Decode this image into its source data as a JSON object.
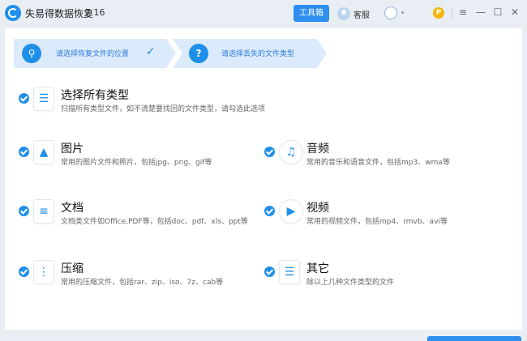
{
  "app": {
    "title": "失易得数据恢复",
    "version": "7.16",
    "toolbox_label": "工具箱",
    "service_label": "客服",
    "user_suffix": "·",
    "vip_letter": "P",
    "min_glyph": "—",
    "menu_glyph": "≡",
    "max_glyph": "☐",
    "close_glyph": "✕"
  },
  "steps": [
    {
      "label": "请选择恢复文件的位置",
      "check": "✓",
      "icon": "⚲"
    },
    {
      "label": "请选择丢失的文件类型",
      "icon": "?"
    }
  ],
  "types": {
    "all": {
      "title": "选择所有类型",
      "desc": "扫描所有类型文件，如不清楚要找回的文件类型，请勾选此选项",
      "glyph": "☰"
    },
    "image": {
      "title": "图片",
      "desc": "常用的图片文件和照片，包括jpg、png、gif等",
      "glyph": "▲"
    },
    "audio": {
      "title": "音频",
      "desc": "常用的音乐和语音文件，包括mp3、wma等",
      "glyph": "♫"
    },
    "doc": {
      "title": "文档",
      "desc": "文档类文件如Office,PDF等，包括doc、pdf、xls、ppt等",
      "glyph": "≡"
    },
    "video": {
      "title": "视频",
      "desc": "常用的视频文件，包括mp4、rmvb、avi等",
      "glyph": "▶"
    },
    "archive": {
      "title": "压缩",
      "desc": "常用的压缩文件，包括rar、zip、iso、7z、cab等",
      "glyph": "⋮"
    },
    "other": {
      "title": "其它",
      "desc": "除以上几种文件类型的文件",
      "glyph": "☰"
    }
  },
  "colors": {
    "accent": "#1f8fe9",
    "step_bg": "#dcebfb"
  }
}
